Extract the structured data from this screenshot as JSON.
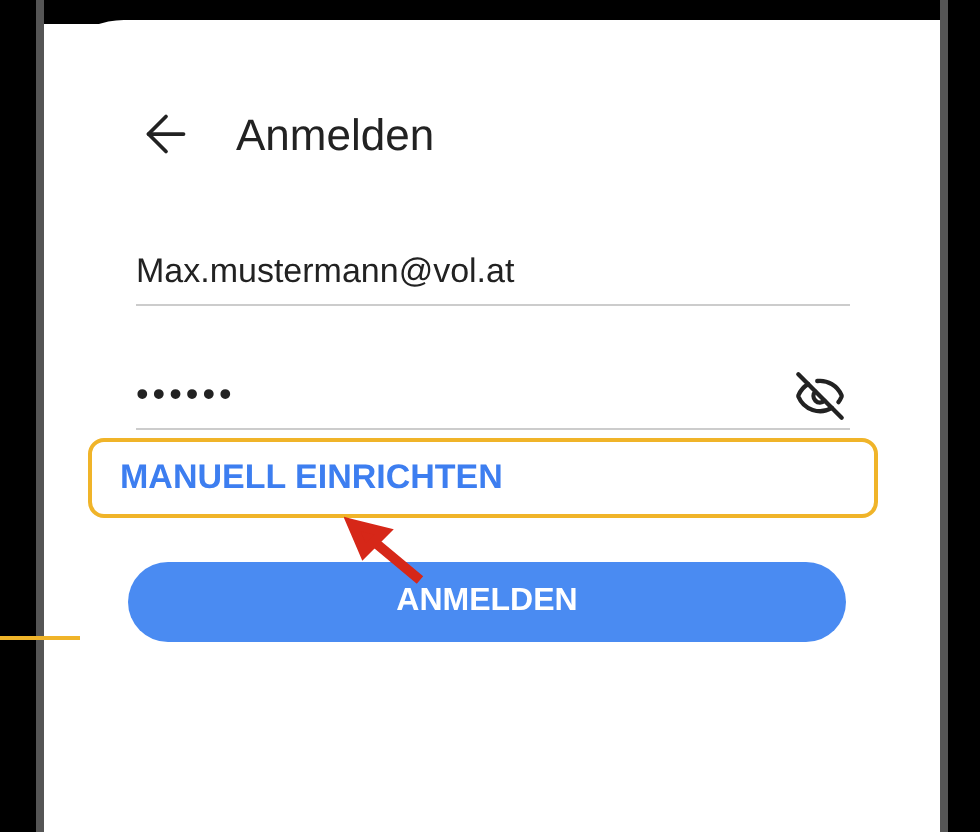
{
  "header": {
    "title": "Anmelden"
  },
  "email": {
    "value": "Max.mustermann@vol.at"
  },
  "password": {
    "value": "••••••",
    "visible": false
  },
  "manual_setup": {
    "label": "MANUELL EINRICHTEN",
    "highlighted": true
  },
  "login_button": {
    "label": "ANMELDEN"
  }
}
